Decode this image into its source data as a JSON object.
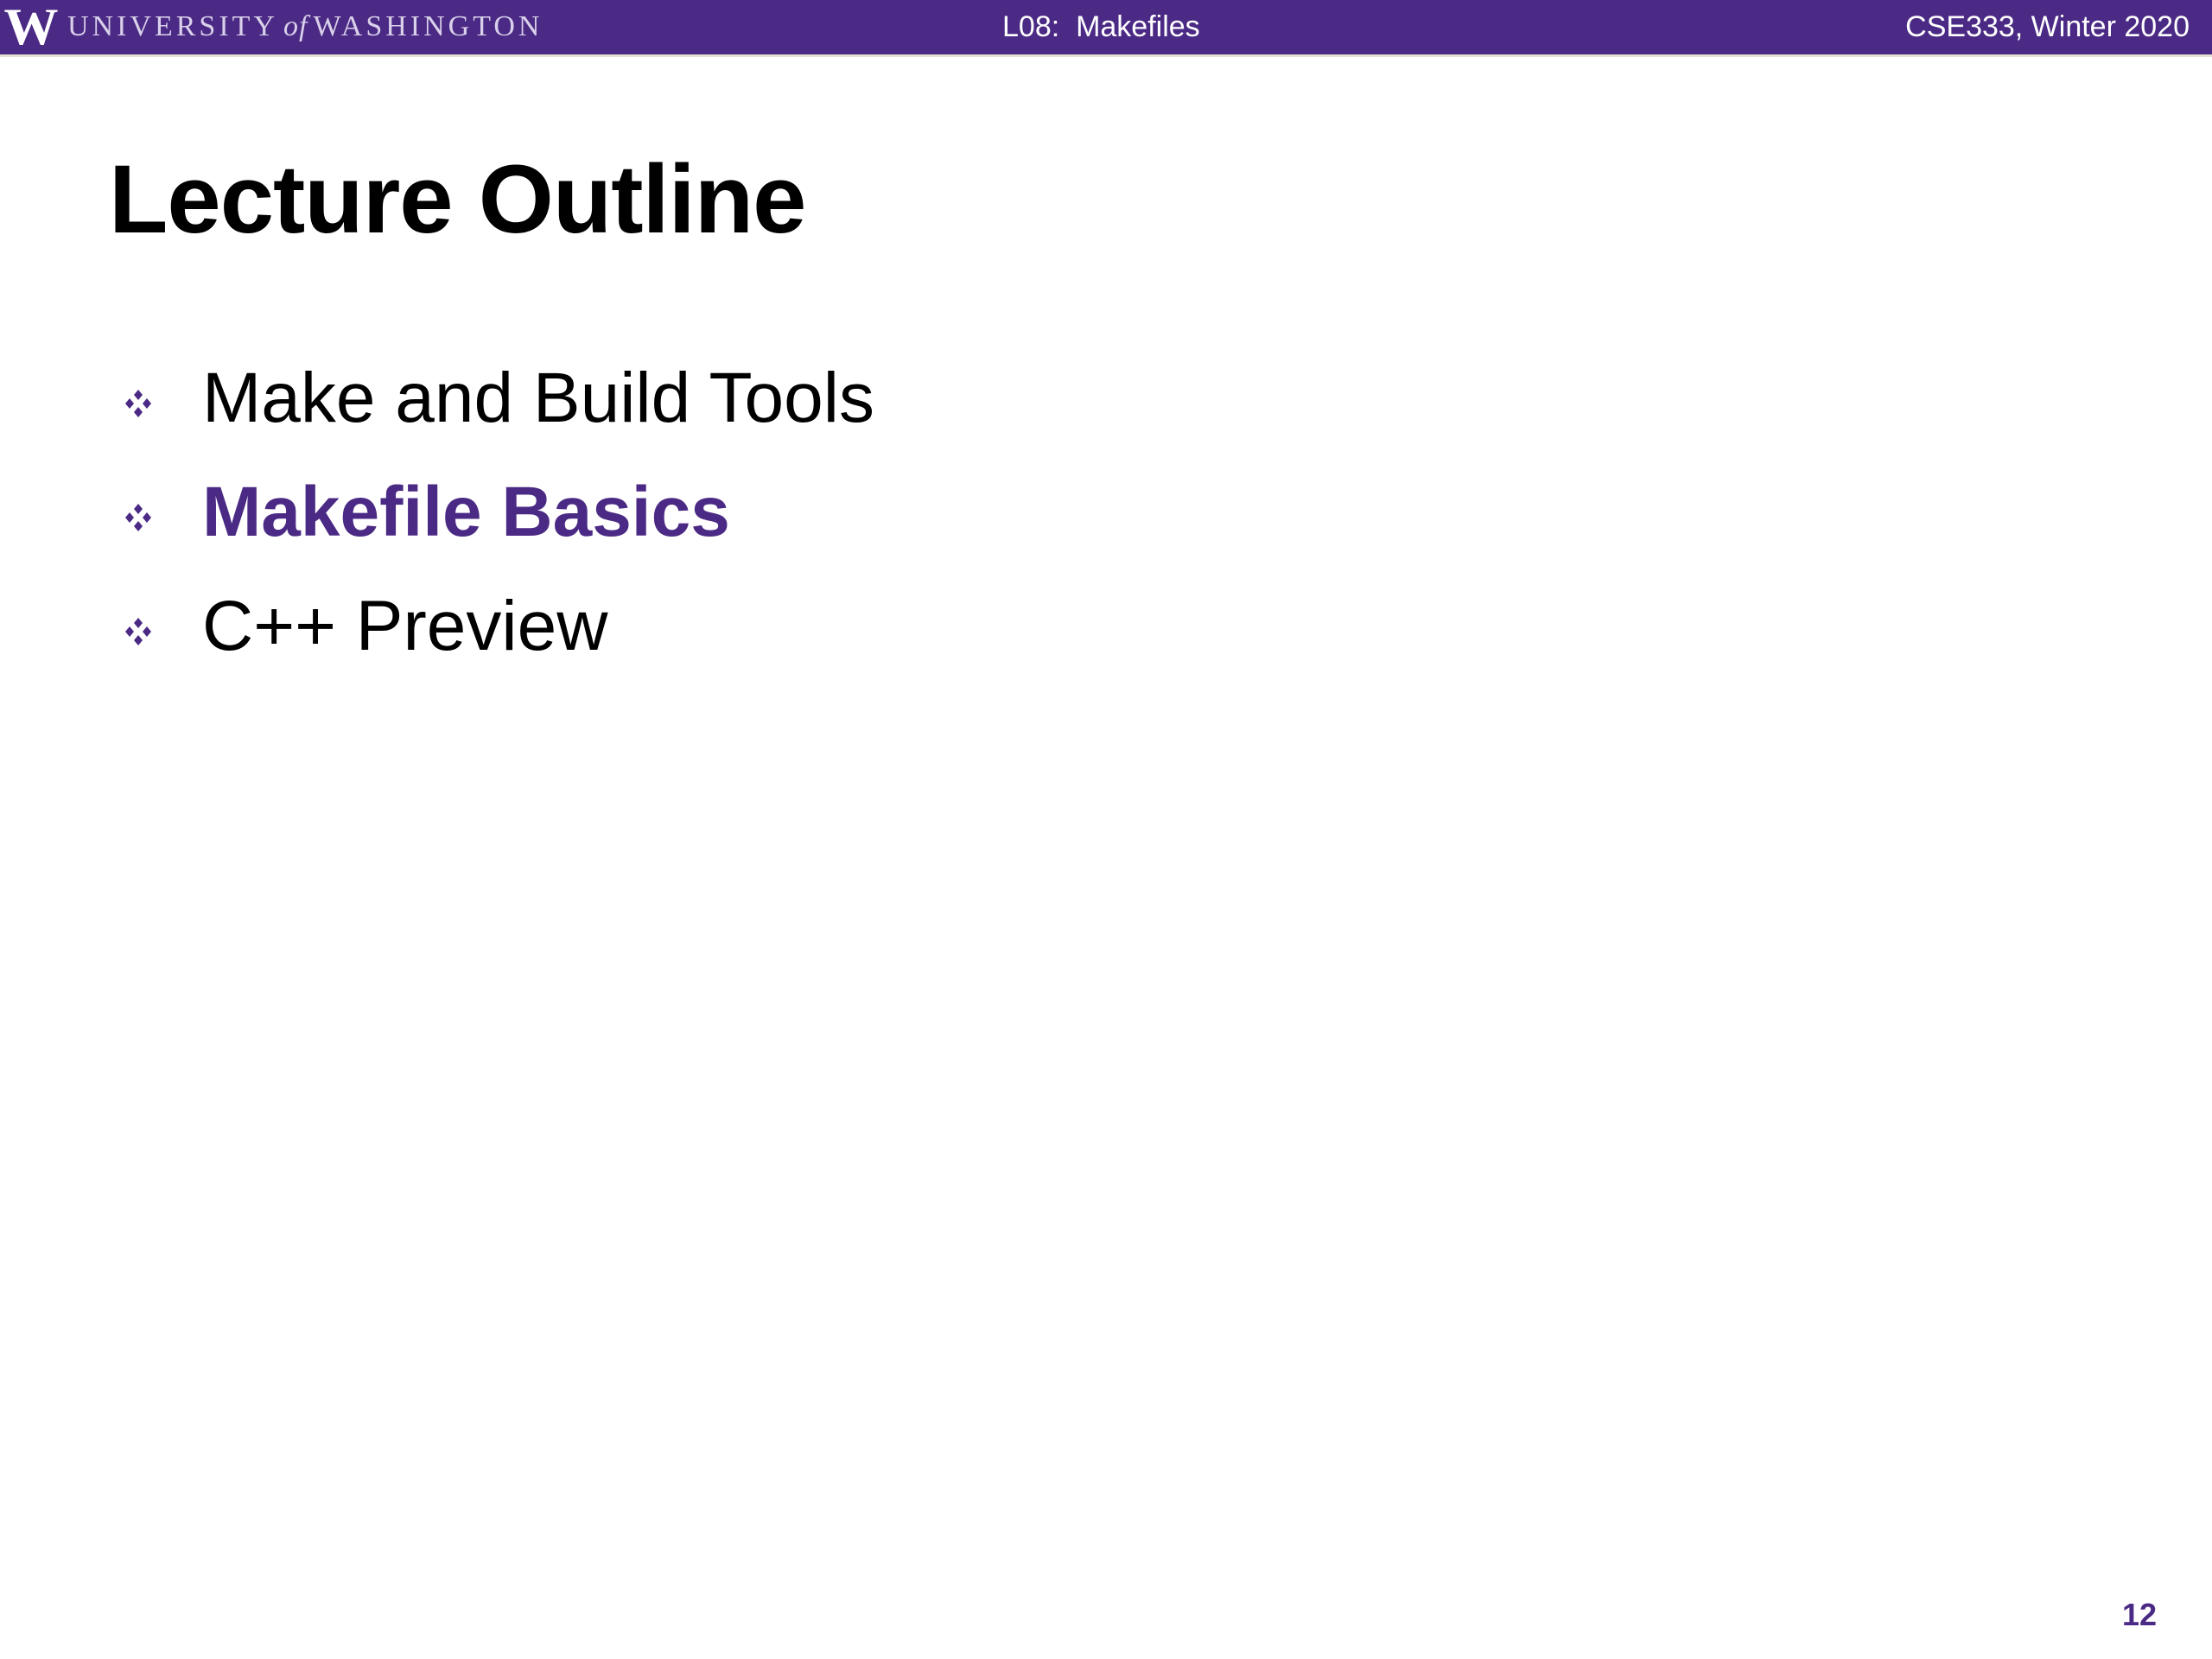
{
  "header": {
    "logo_letter": "W",
    "university_part1": "UNIVERSITY",
    "university_of": "of",
    "university_part2": "WASHINGTON",
    "lecture": "L08:  Makefiles",
    "course": "CSE333, Winter 2020"
  },
  "slide": {
    "title": "Lecture Outline",
    "bullets": [
      {
        "label": "Make and Build Tools",
        "active": false
      },
      {
        "label": "Makefile Basics",
        "active": true
      },
      {
        "label": "C++ Preview",
        "active": false
      }
    ],
    "page_number": "12"
  },
  "colors": {
    "brand_purple": "#4b2a85",
    "text": "#000000",
    "background": "#ffffff"
  },
  "icons": {
    "bullet": "four-diamond-bullet-icon"
  }
}
